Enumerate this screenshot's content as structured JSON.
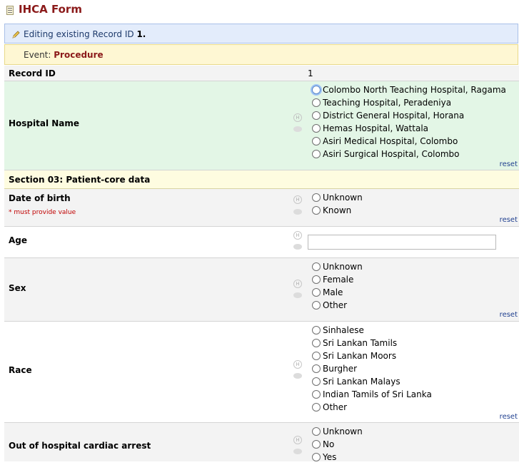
{
  "form": {
    "title": "IHCA Form"
  },
  "edit_bar": {
    "prefix": "Editing existing Record ID",
    "record_id": "1."
  },
  "event_bar": {
    "prefix": "Event:",
    "event_name": "Procedure"
  },
  "reset_label": "reset",
  "fields": {
    "record_id": {
      "label": "Record ID",
      "value": "1"
    },
    "hospital": {
      "label": "Hospital Name",
      "options": [
        "Colombo North Teaching Hospital, Ragama",
        "Teaching Hospital, Peradeniya",
        "District General Hospital, Horana",
        "Hemas Hospital, Wattala",
        "Asiri Medical Hospital, Colombo",
        "Asiri Surgical Hospital, Colombo"
      ]
    },
    "section3": {
      "label": "Section 03: Patient-core data"
    },
    "dob": {
      "label": "Date of birth",
      "note": "* must provide value",
      "options": [
        "Unknown",
        "Known"
      ]
    },
    "age": {
      "label": "Age",
      "value": ""
    },
    "sex": {
      "label": "Sex",
      "options": [
        "Unknown",
        "Female",
        "Male",
        "Other"
      ]
    },
    "race": {
      "label": "Race",
      "options": [
        "Sinhalese",
        "Sri Lankan Tamils",
        "Sri Lankan Moors",
        "Burgher",
        "Sri Lankan Malays",
        "Indian Tamils of Sri Lanka",
        "Other"
      ]
    },
    "ohca": {
      "label": "Out of hospital cardiac arrest",
      "options": [
        "Unknown",
        "No",
        "Yes"
      ]
    }
  },
  "icon_names": {
    "form": "form-icon",
    "edit": "pencil-icon",
    "help": "field-help-icon",
    "comment": "comment-icon"
  }
}
